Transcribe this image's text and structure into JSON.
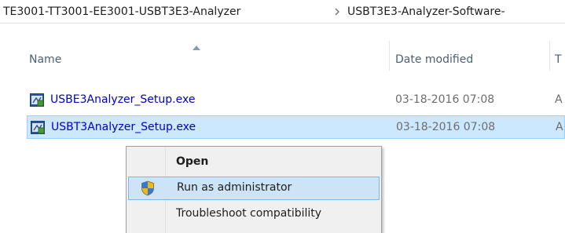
{
  "breadcrumb": {
    "folder1": "TE3001-TT3001-EE3001-USBT3E3-Analyzer",
    "folder2": "USBT3E3-Analyzer-Software-"
  },
  "columns": {
    "name": "Name",
    "date_modified": "Date modified",
    "type": "T"
  },
  "files": [
    {
      "name": "USBE3Analyzer_Setup.exe",
      "date": "03-18-2016 07:08",
      "type": "A",
      "icon": "setup-exe-icon"
    },
    {
      "name": "USBT3Analyzer_Setup.exe",
      "date": "03-18-2016 07:08",
      "type": "A",
      "icon": "setup-exe-icon",
      "selected": true
    }
  ],
  "context_menu": {
    "items": [
      {
        "label": "Open",
        "default": true
      },
      {
        "label": "Run as administrator",
        "icon": "uac-shield-icon",
        "highlighted": true
      },
      {
        "label": "Troubleshoot compatibility"
      }
    ]
  },
  "colors": {
    "selection_bg": "#cce8ff",
    "selection_border": "#99d1ff",
    "link_text": "#0000cc",
    "header_text": "#4c607a",
    "menu_bg": "#f0f0f0",
    "menu_highlight": "#cde4f7"
  }
}
